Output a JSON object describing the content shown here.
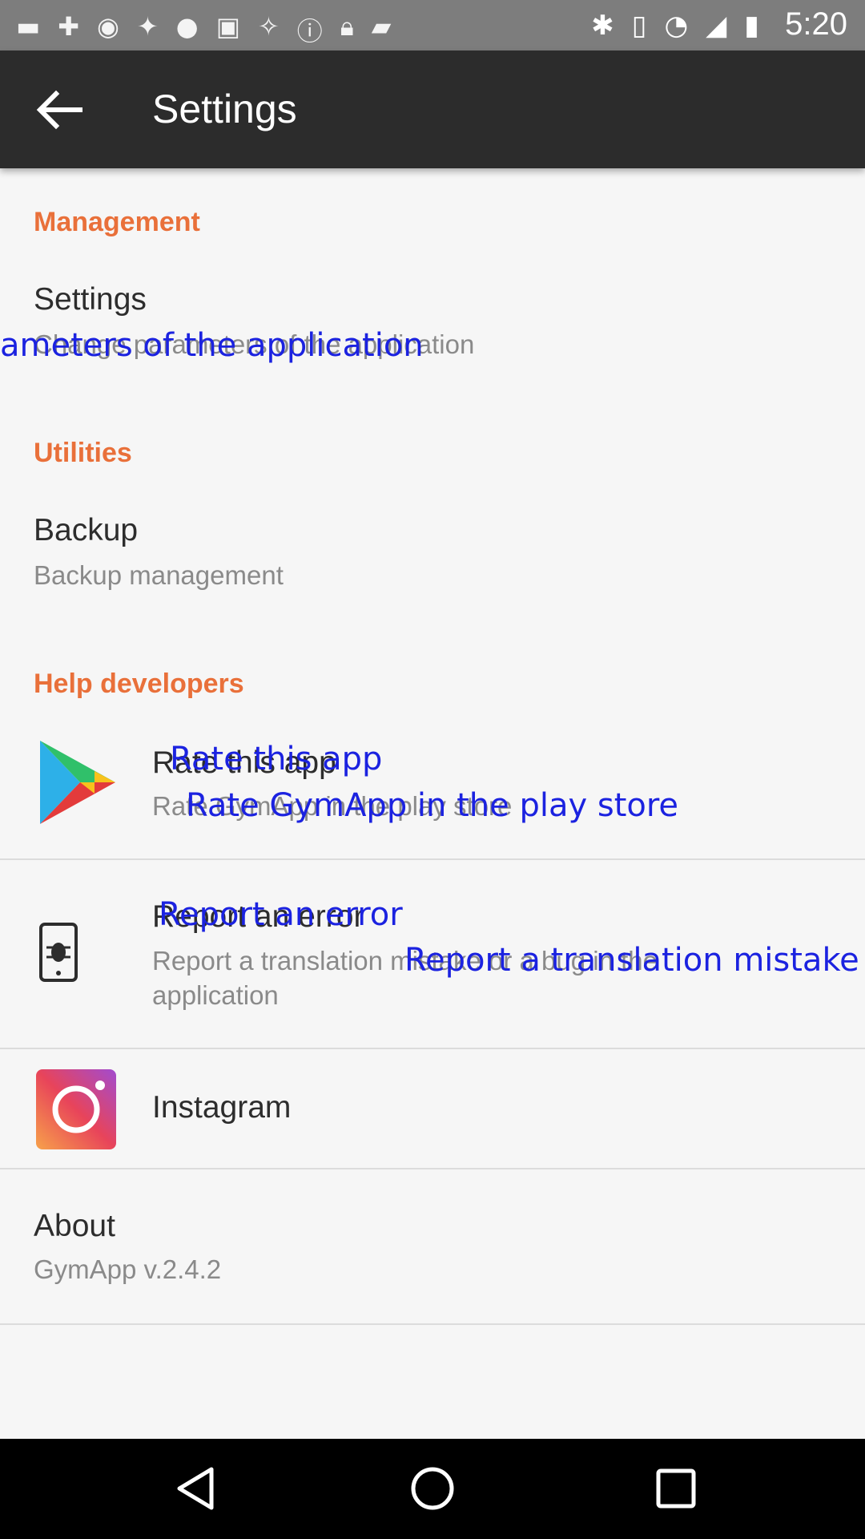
{
  "status_bar": {
    "time": "5:20",
    "left_icons": [
      "chat-icon",
      "gymapp-icon",
      "fake-gps-icon",
      "satellite-icon",
      "circle-icon",
      "gallery-icon",
      "satellite2-icon",
      "alert-icon",
      "lock-icon",
      "android-icon"
    ],
    "right_icons": [
      "bluetooth-icon",
      "vibrate-icon",
      "wifi-icon",
      "signal-icon",
      "battery-icon"
    ]
  },
  "app_bar": {
    "title": "Settings"
  },
  "sections": {
    "management": "Management",
    "utilities": "Utilities",
    "help": "Help developers"
  },
  "items": {
    "settings": {
      "title": "Settings",
      "summary": "Change parameters of the application",
      "overlay_summary": "ameters of the application"
    },
    "backup": {
      "title": "Backup",
      "summary": "Backup management"
    },
    "rate": {
      "title": "Rate this app",
      "summary": "Rate GymApp in the play store",
      "overlay_title": "Rate this app",
      "overlay_summary": "Rate GymApp in the play store"
    },
    "report": {
      "title": "Report an error",
      "summary_line1": "Report a translation mistake or a bug in the",
      "summary_line2": "application",
      "overlay_title": "Report an error",
      "overlay_summary": "Report a translation mistake o"
    },
    "instagram": {
      "title": "Instagram"
    },
    "about": {
      "title": "About",
      "summary": "GymApp v.2.4.2"
    }
  },
  "colors": {
    "accent": "#e9703a",
    "toolbar": "#2c2c2c",
    "overlay_text": "#1b22e0"
  }
}
